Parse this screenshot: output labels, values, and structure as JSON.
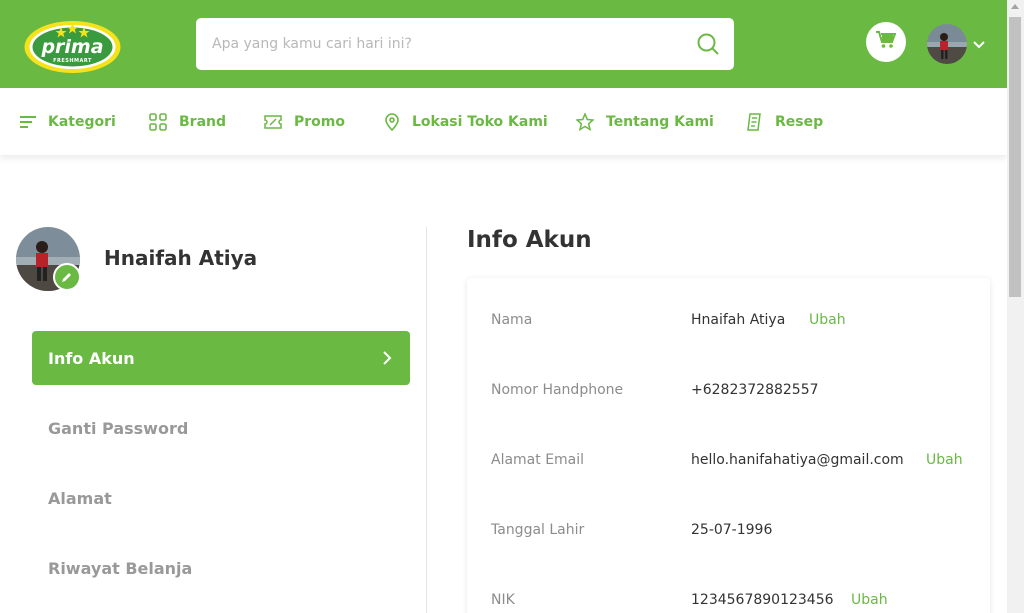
{
  "header": {
    "logo_text": "prima",
    "logo_subtext": "FRESHMART",
    "search_placeholder": "Apa yang kamu cari hari ini?",
    "brand_color": "#6ab943"
  },
  "nav": {
    "items": [
      {
        "label": "Kategori",
        "icon": "menu-icon"
      },
      {
        "label": "Brand",
        "icon": "grid-icon"
      },
      {
        "label": "Promo",
        "icon": "ticket-icon"
      },
      {
        "label": "Lokasi Toko Kami",
        "icon": "location-pin-icon"
      },
      {
        "label": "Tentang Kami",
        "icon": "star-icon"
      },
      {
        "label": "Resep",
        "icon": "receipt-icon"
      }
    ]
  },
  "profile": {
    "name": "Hnaifah Atiya"
  },
  "sidebar": {
    "items": [
      {
        "label": "Info Akun",
        "active": true
      },
      {
        "label": "Ganti Password",
        "active": false
      },
      {
        "label": "Alamat",
        "active": false
      },
      {
        "label": "Riwayat Belanja",
        "active": false
      }
    ]
  },
  "account": {
    "title": "Info Akun",
    "rows": [
      {
        "label": "Nama",
        "value": "Hnaifah Atiya",
        "action": "Ubah"
      },
      {
        "label": "Nomor Handphone",
        "value": "+6282372882557",
        "action": ""
      },
      {
        "label": "Alamat Email",
        "value": "hello.hanifahatiya@gmail.com",
        "action": "Ubah"
      },
      {
        "label": "Tanggal Lahir",
        "value": "25-07-1996",
        "action": ""
      },
      {
        "label": "NIK",
        "value": "1234567890123456",
        "action": "Ubah"
      }
    ]
  }
}
